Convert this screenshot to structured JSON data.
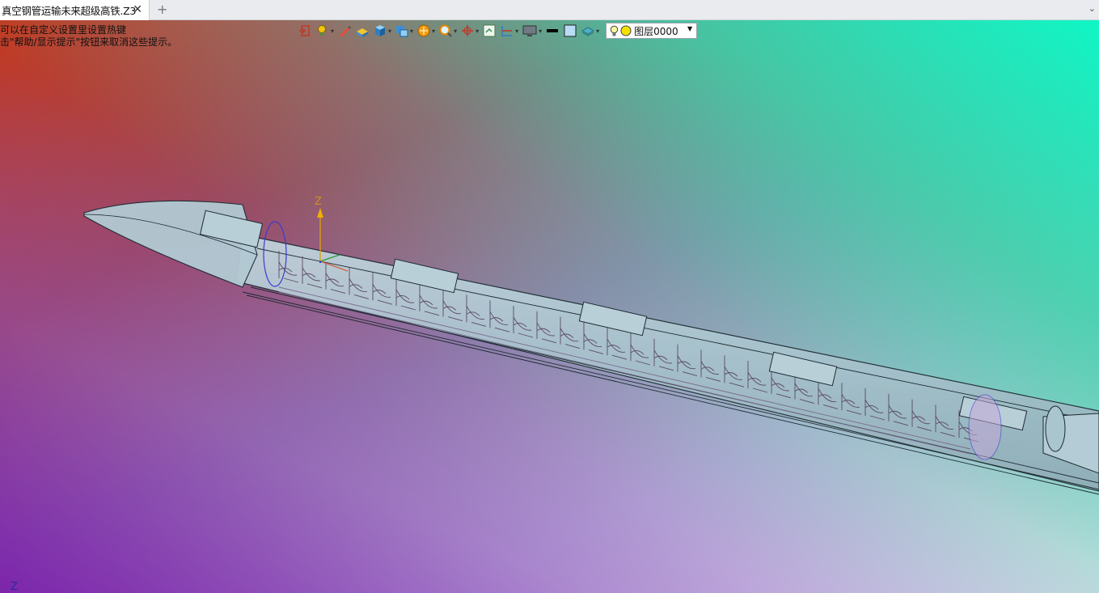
{
  "tab": {
    "title": "真空钢管运输未来超级高铁.Z3",
    "close": "✕",
    "add": "+",
    "menu": "⌄"
  },
  "hints": {
    "line1": "可以在自定义设置里设置热键",
    "line2": "击\"帮助/显示提示\"按钮来取消这些提示。"
  },
  "toolbar": {
    "items": [
      {
        "icon": "exit-view-icon"
      },
      {
        "icon": "lightbulb-settings-icon",
        "dropdown": true
      },
      {
        "icon": "pen-icon"
      },
      {
        "icon": "solid-block-icon"
      },
      {
        "icon": "cube-view-icon",
        "dropdown": true
      },
      {
        "icon": "display-mode-icon",
        "dropdown": true
      },
      {
        "icon": "render-sphere-icon",
        "dropdown": true
      },
      {
        "icon": "zoom-icon",
        "dropdown": true
      },
      {
        "icon": "axis-crosshair-icon",
        "dropdown": true
      },
      {
        "icon": "fit-view-icon"
      },
      {
        "icon": "section-view-icon",
        "dropdown": true
      },
      {
        "icon": "monitor-icon",
        "dropdown": true
      },
      {
        "icon": "line-style-icon"
      },
      {
        "icon": "color-swatch-icon"
      },
      {
        "icon": "layer-stack-icon",
        "dropdown": true
      }
    ],
    "layer": {
      "value": "图层0000"
    }
  },
  "triad": {
    "z_label": "Z",
    "corner_label": "Z"
  },
  "colors": {
    "tube": "#a9c5d0",
    "tube_edge": "#1c2a30",
    "accent": "#e0a000"
  }
}
